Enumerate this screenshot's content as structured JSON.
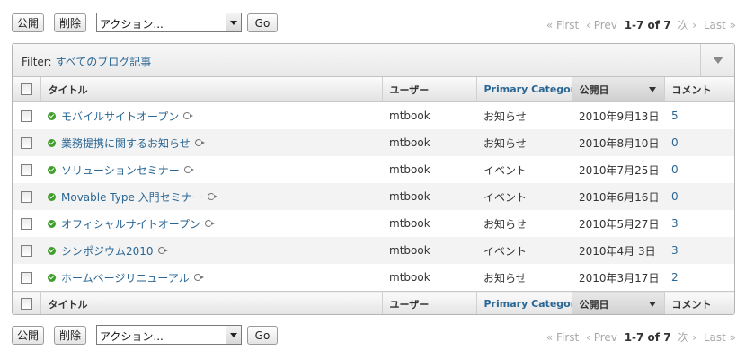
{
  "actions": {
    "publish_label": "公開",
    "delete_label": "削除",
    "action_select_value": "アクション...",
    "go_label": "Go"
  },
  "pager": {
    "first": "« First",
    "prev": "‹ Prev",
    "count": "1-7 of 7",
    "next": "次 ›",
    "last": "Last »"
  },
  "filter": {
    "label": "Filter:",
    "name": "すべてのブログ記事"
  },
  "columns": {
    "title": "タイトル",
    "user": "ユーザー",
    "category": "Primary Category",
    "date": "公開日",
    "comments": "コメント"
  },
  "entries": [
    {
      "title": "モバイルサイトオープン",
      "user": "mtbook",
      "category": "お知らせ",
      "date": "2010年9月13日",
      "comments": "5"
    },
    {
      "title": "業務提携に関するお知らせ",
      "user": "mtbook",
      "category": "お知らせ",
      "date": "2010年8月10日",
      "comments": "0"
    },
    {
      "title": "ソリューションセミナー",
      "user": "mtbook",
      "category": "イベント",
      "date": "2010年7月25日",
      "comments": "0"
    },
    {
      "title": "Movable Type 入門セミナー",
      "user": "mtbook",
      "category": "イベント",
      "date": "2010年6月16日",
      "comments": "0"
    },
    {
      "title": "オフィシャルサイトオープン",
      "user": "mtbook",
      "category": "お知らせ",
      "date": "2010年5月27日",
      "comments": "3"
    },
    {
      "title": "シンポジウム2010",
      "user": "mtbook",
      "category": "イベント",
      "date": "2010年4月 3日",
      "comments": "3"
    },
    {
      "title": "ホームページリニューアル",
      "user": "mtbook",
      "category": "お知らせ",
      "date": "2010年3月17日",
      "comments": "2"
    }
  ],
  "colors": {
    "link": "#2a6794",
    "published": "#3f9f2a"
  }
}
